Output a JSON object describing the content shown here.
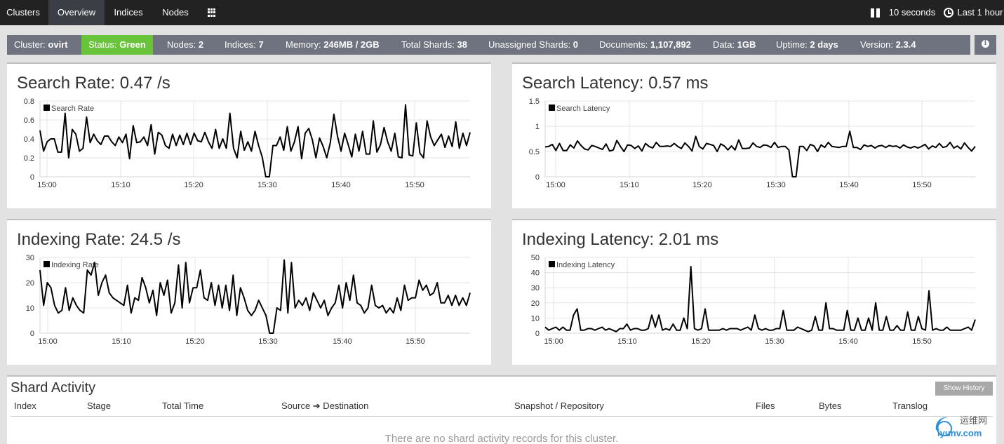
{
  "nav": {
    "tabs": [
      {
        "label": "Clusters",
        "active": false
      },
      {
        "label": "Overview",
        "active": true
      },
      {
        "label": "Indices",
        "active": false
      },
      {
        "label": "Nodes",
        "active": false
      }
    ],
    "apps_icon": "apps-grid-icon",
    "refresh_label": "10 seconds",
    "time_range_label": "Last 1 hour"
  },
  "status": {
    "cluster_label": "Cluster:",
    "cluster_value": "ovirt",
    "status_label": "Status:",
    "status_value": "Green",
    "nodes_label": "Nodes:",
    "nodes_value": "2",
    "indices_label": "Indices:",
    "indices_value": "7",
    "memory_label": "Memory:",
    "memory_value": "246MB / 2GB",
    "shards_label": "Total Shards:",
    "shards_value": "38",
    "unassigned_label": "Unassigned Shards:",
    "unassigned_value": "0",
    "documents_label": "Documents:",
    "documents_value": "1,107,892",
    "data_label": "Data:",
    "data_value": "1GB",
    "uptime_label": "Uptime:",
    "uptime_value": "2 days",
    "version_label": "Version:",
    "version_value": "2.3.4",
    "status_color": "#69c33b",
    "bar_color": "#6f7380"
  },
  "panels": {
    "search_rate_title": "Search Rate: 0.47 /s",
    "search_latency_title": "Search Latency: 0.57 ms",
    "indexing_rate_title": "Indexing Rate: 24.5 /s",
    "indexing_latency_title": "Indexing Latency: 2.01 ms"
  },
  "chart_data": [
    {
      "type": "line",
      "legend": "Search Rate",
      "y_ticks": [
        "0",
        "0.2",
        "0.4",
        "0.6",
        "0.8"
      ],
      "ylim": [
        0,
        0.8
      ],
      "x_ticks": [
        "15:00",
        "15:10",
        "15:20",
        "15:30",
        "15:40",
        "15:50"
      ],
      "grid": true,
      "series": [
        {
          "name": "Search Rate",
          "values": [
            0.49,
            0.27,
            0.37,
            0.4,
            0.4,
            0.26,
            0.26,
            0.67,
            0.2,
            0.5,
            0.45,
            0.27,
            0.3,
            0.63,
            0.36,
            0.45,
            0.38,
            0.34,
            0.43,
            0.43,
            0.37,
            0.33,
            0.42,
            0.36,
            0.45,
            0.19,
            0.54,
            0.36,
            0.37,
            0.42,
            0.33,
            0.55,
            0.24,
            0.47,
            0.44,
            0.33,
            0.3,
            0.45,
            0.33,
            0.44,
            0.34,
            0.46,
            0.34,
            0.46,
            0.38,
            0.37,
            0.47,
            0.37,
            0.3,
            0.5,
            0.3,
            0.4,
            0.3,
            0.67,
            0.3,
            0.2,
            0.48,
            0.28,
            0.37,
            0.27,
            0.48,
            0.33,
            0.21,
            0.0,
            0.0,
            0.33,
            0.33,
            0.42,
            0.28,
            0.53,
            0.27,
            0.37,
            0.53,
            0.19,
            0.46,
            0.51,
            0.39,
            0.2,
            0.41,
            0.32,
            0.2,
            0.36,
            0.66,
            0.43,
            0.27,
            0.46,
            0.34,
            0.21,
            0.45,
            0.27,
            0.48,
            0.24,
            0.24,
            0.59,
            0.26,
            0.34,
            0.52,
            0.37,
            0.27,
            0.46,
            0.21,
            0.2,
            0.76,
            0.23,
            0.22,
            0.57,
            0.25,
            0.2,
            0.59,
            0.42,
            0.33,
            0.39,
            0.45,
            0.31,
            0.43,
            0.32,
            0.58,
            0.3,
            0.46,
            0.33,
            0.47
          ]
        }
      ]
    },
    {
      "type": "line",
      "legend": "Search Latency",
      "y_ticks": [
        "0",
        "0.5",
        "1",
        "1.5"
      ],
      "ylim": [
        0,
        1.5
      ],
      "x_ticks": [
        "15:00",
        "15:10",
        "15:20",
        "15:30",
        "15:40",
        "15:50"
      ],
      "grid": true,
      "series": [
        {
          "name": "Search Latency",
          "values": [
            0.59,
            0.6,
            0.64,
            0.52,
            0.66,
            0.52,
            0.52,
            0.63,
            0.57,
            0.71,
            0.62,
            0.55,
            0.53,
            0.62,
            0.6,
            0.57,
            0.54,
            0.65,
            0.51,
            0.53,
            0.72,
            0.6,
            0.5,
            0.63,
            0.62,
            0.56,
            0.61,
            0.51,
            0.66,
            0.6,
            0.57,
            0.68,
            0.6,
            0.6,
            0.61,
            0.6,
            0.66,
            0.6,
            0.56,
            0.67,
            0.6,
            0.51,
            0.8,
            0.6,
            0.55,
            0.66,
            0.64,
            0.62,
            0.5,
            0.65,
            0.61,
            0.53,
            0.61,
            0.53,
            0.73,
            0.56,
            0.56,
            0.57,
            0.67,
            0.6,
            0.58,
            0.63,
            0.62,
            0.58,
            0.68,
            0.58,
            0.6,
            0.6,
            0.53,
            0.0,
            0.0,
            0.6,
            0.6,
            0.52,
            0.64,
            0.61,
            0.5,
            0.63,
            0.58,
            0.68,
            0.6,
            0.59,
            0.58,
            0.6,
            0.6,
            0.9,
            0.58,
            0.58,
            0.54,
            0.63,
            0.6,
            0.62,
            0.57,
            0.61,
            0.62,
            0.58,
            0.62,
            0.6,
            0.61,
            0.57,
            0.63,
            0.59,
            0.57,
            0.6,
            0.57,
            0.6,
            0.64,
            0.55,
            0.61,
            0.58,
            0.66,
            0.58,
            0.6,
            0.68,
            0.57,
            0.61,
            0.55,
            0.67,
            0.58,
            0.51,
            0.6
          ]
        }
      ]
    },
    {
      "type": "line",
      "legend": "Indexing Rate",
      "y_ticks": [
        "0",
        "10",
        "20",
        "30"
      ],
      "ylim": [
        0,
        30
      ],
      "x_ticks": [
        "15:00",
        "15:10",
        "15:20",
        "15:30",
        "15:40",
        "15:50"
      ],
      "grid": true,
      "series": [
        {
          "name": "Indexing Rate",
          "values": [
            25,
            11,
            20,
            18,
            11,
            8,
            9,
            18,
            9,
            14,
            11,
            9,
            8,
            25,
            23,
            28,
            15,
            20,
            23,
            16,
            14,
            13,
            12,
            11,
            19,
            8,
            14,
            13,
            22,
            18,
            12,
            17,
            7,
            20,
            15,
            21,
            8,
            12,
            27,
            10,
            28,
            12,
            18,
            18,
            25,
            14,
            13,
            20,
            11,
            19,
            10,
            19,
            9,
            23,
            7,
            18,
            14,
            9,
            7,
            9,
            13,
            10,
            7,
            0,
            0,
            10,
            9,
            29,
            8,
            28,
            10,
            13,
            11,
            14,
            9,
            16,
            13,
            10,
            13,
            7,
            10,
            12,
            19,
            10,
            20,
            13,
            23,
            12,
            11,
            8,
            10,
            19,
            11,
            10,
            11,
            8,
            10,
            8,
            14,
            9,
            19,
            13,
            14,
            14,
            21,
            17,
            19,
            15,
            16,
            20,
            12,
            12,
            15,
            11,
            15,
            11,
            14,
            11,
            16
          ]
        }
      ]
    },
    {
      "type": "line",
      "legend": "Indexing Latency",
      "y_ticks": [
        "0",
        "10",
        "20",
        "30",
        "40",
        "50"
      ],
      "ylim": [
        0,
        50
      ],
      "x_ticks": [
        "15:00",
        "15:10",
        "15:20",
        "15:30",
        "15:40",
        "15:50"
      ],
      "grid": true,
      "series": [
        {
          "name": "Indexing Latency",
          "values": [
            4,
            2,
            3,
            4,
            2,
            4,
            2,
            2,
            12,
            16,
            2,
            2,
            3,
            3,
            2,
            3,
            4,
            2,
            3,
            2,
            1,
            3,
            3,
            6,
            2,
            3,
            3,
            2,
            2,
            3,
            12,
            4,
            12,
            2,
            3,
            2,
            6,
            2,
            2,
            10,
            3,
            44,
            3,
            2,
            3,
            16,
            2,
            2,
            2,
            2,
            3,
            2,
            3,
            3,
            3,
            2,
            3,
            4,
            2,
            12,
            3,
            2,
            3,
            2,
            2,
            3,
            3,
            15,
            2,
            2,
            2,
            4,
            3,
            2,
            1,
            2,
            11,
            2,
            2,
            20,
            3,
            3,
            2,
            2,
            2,
            15,
            2,
            2,
            10,
            2,
            2,
            10,
            2,
            20,
            2,
            2,
            11,
            2,
            2,
            5,
            2,
            2,
            14,
            2,
            2,
            11,
            3,
            2,
            28,
            2,
            3,
            2,
            2,
            4,
            2,
            2,
            2,
            2,
            3,
            4,
            2,
            9
          ]
        }
      ]
    }
  ],
  "shard_activity": {
    "title": "Shard Activity",
    "history_button": "Show History",
    "columns": [
      "Index",
      "Stage",
      "Total Time",
      "Source ➔ Destination",
      "Snapshot / Repository",
      "Files",
      "Bytes",
      "Translog"
    ],
    "empty_message": "There are no shard activity records for this cluster."
  },
  "watermark": {
    "text_cn": "运维网",
    "text_url": "iyunv.com"
  }
}
